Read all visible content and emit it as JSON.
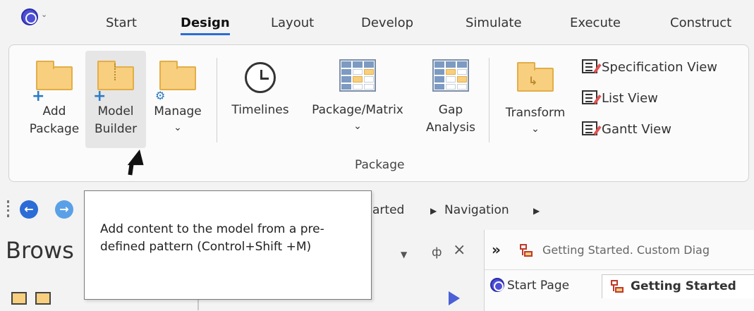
{
  "tabs": [
    "Start",
    "Design",
    "Layout",
    "Develop",
    "Simulate",
    "Execute",
    "Construct"
  ],
  "active_tab": "Design",
  "ribbon": {
    "add_package": [
      "Add",
      "Package"
    ],
    "model_builder": [
      "Model",
      "Builder"
    ],
    "manage": "Manage",
    "timelines": "Timelines",
    "package_matrix": "Package/Matrix",
    "gap_analysis": [
      "Gap",
      "Analysis"
    ],
    "transform": "Transform",
    "views": [
      "Specification View",
      "List View",
      "Gantt View"
    ],
    "group_label": "Package"
  },
  "nav": {
    "crumb_partial": "arted",
    "crumb_navigation": "Navigation"
  },
  "browser": {
    "title": "Brows",
    "pin": "ф",
    "close": "×"
  },
  "diagram": {
    "header_title": "Getting Started.  Custom Diag",
    "tab_start_page": "Start Page",
    "tab_getting_started": "Getting Started"
  },
  "tooltip": {
    "text": "Add content to the model from a pre-defined pattern (Control+Shift +M)"
  },
  "colors": {
    "accent": "#2b6cd6",
    "folder": "#f8cf7e",
    "folder_border": "#e2ae49",
    "nav_back": "#2b6cd6",
    "nav_forward": "#5aa0e6"
  }
}
